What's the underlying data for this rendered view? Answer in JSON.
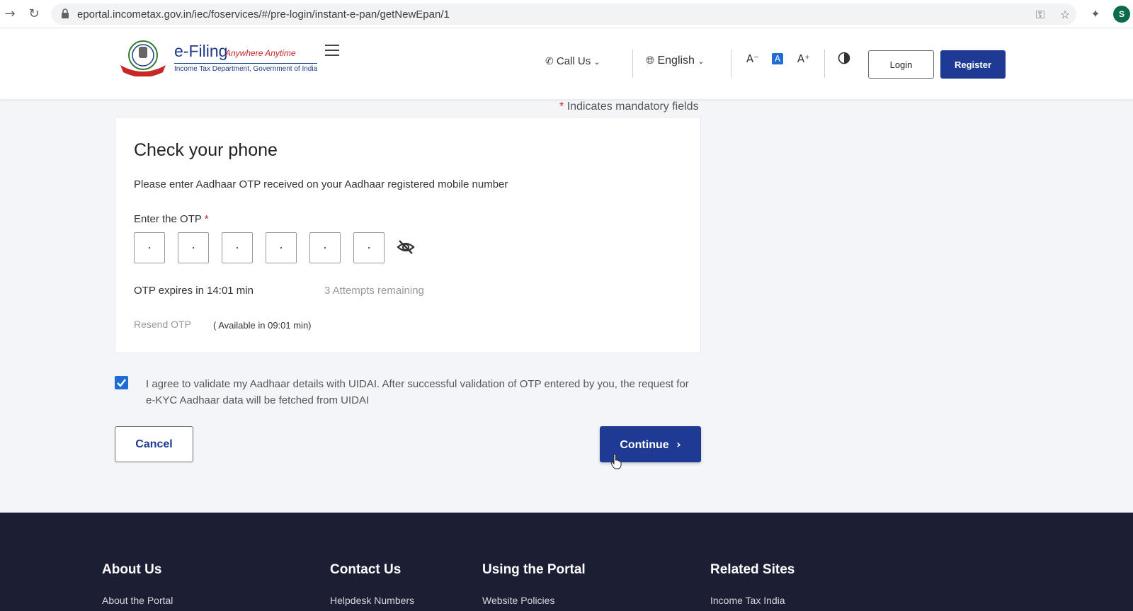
{
  "browser": {
    "url": "eportal.incometax.gov.in/iec/foservices/#/pre-login/instant-e-pan/getNewEpan/1",
    "profile_initial": "S"
  },
  "header": {
    "brand": "e-Filing",
    "tagline": "Anywhere Anytime",
    "dept": "Income Tax Department, Government of India",
    "call_us": "Call Us",
    "language": "English",
    "font_decrease": "A⁻",
    "font_normal": "A",
    "font_increase": "A⁺",
    "login_label": "Login",
    "register_label": "Register"
  },
  "form": {
    "mandatory_star": "*",
    "mandatory_note": "Indicates mandatory fields",
    "title": "Check your phone",
    "description": "Please enter Aadhaar OTP received on your Aadhaar registered mobile number",
    "otp_label": "Enter the OTP",
    "otp_star": "*",
    "otp_digits": [
      "·",
      "·",
      "·",
      "·",
      "·",
      "·"
    ],
    "expires": "OTP expires in 14:01 min",
    "attempts": "3 Attempts remaining",
    "resend": "Resend OTP",
    "available": "( Available in 09:01 min)",
    "agree_checked": true,
    "agree_text": "I agree to validate my Aadhaar details with UIDAI. After successful validation of OTP entered by you, the request for e-KYC Aadhaar data will be fetched from UIDAI",
    "cancel_label": "Cancel",
    "continue_label": "Continue"
  },
  "footer": {
    "columns": [
      {
        "title": "About Us",
        "link": "About the Portal"
      },
      {
        "title": "Contact Us",
        "link": "Helpdesk Numbers"
      },
      {
        "title": "Using the Portal",
        "link": "Website Policies"
      },
      {
        "title": "Related Sites",
        "link": "Income Tax India"
      }
    ]
  },
  "colors": {
    "primary": "#1f3a93",
    "checkbox": "#1f6cd6",
    "mandatory": "#c62828",
    "footer_bg": "#1c1e33"
  }
}
